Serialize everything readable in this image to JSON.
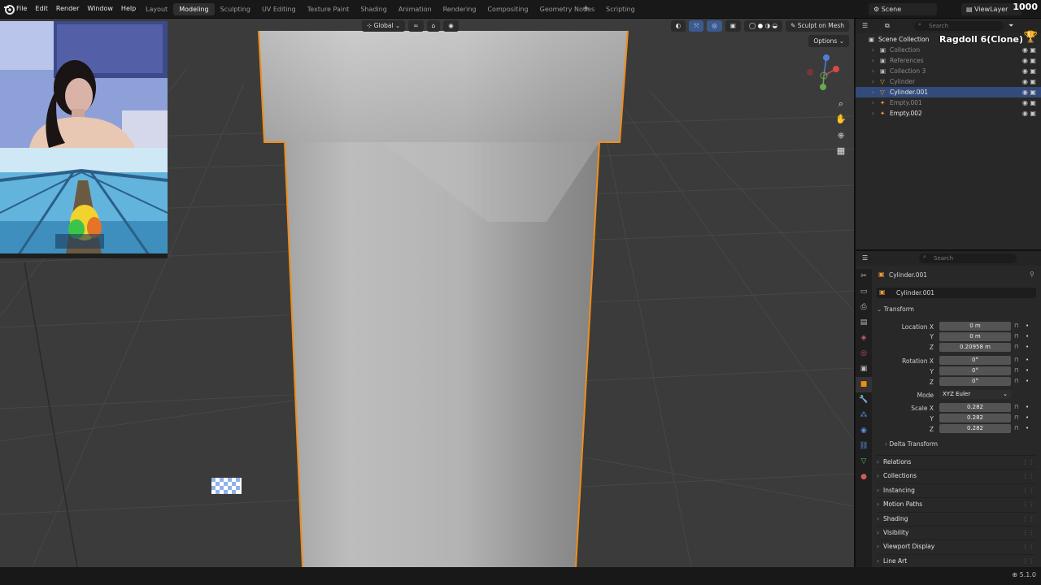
{
  "menu": [
    "File",
    "Edit",
    "Render",
    "Window",
    "Help"
  ],
  "workspaces": [
    {
      "label": "Layout",
      "active": false
    },
    {
      "label": "Modeling",
      "active": true
    },
    {
      "label": "Sculpting",
      "active": false
    },
    {
      "label": "UV Editing",
      "active": false
    },
    {
      "label": "Texture Paint",
      "active": false
    },
    {
      "label": "Shading",
      "active": false
    },
    {
      "label": "Animation",
      "active": false
    },
    {
      "label": "Rendering",
      "active": false
    },
    {
      "label": "Compositing",
      "active": false
    },
    {
      "label": "Geometry Nodes",
      "active": false
    },
    {
      "label": "Scripting",
      "active": false
    }
  ],
  "add_workspace": "+",
  "scene": "Scene",
  "view_layer": "ViewLayer",
  "frame": "1000",
  "viewport": {
    "orientation": "Global",
    "sculpt_on_mesh": "Sculpt on Mesh",
    "options": "Options"
  },
  "outliner": {
    "search_placeholder": "Search",
    "scene_collection": "Scene Collection",
    "overlay_title": "Ragdoll 6(Clone)",
    "items": [
      {
        "name": "Collection",
        "selected": false,
        "dim": true
      },
      {
        "name": "References",
        "selected": false,
        "dim": true
      },
      {
        "name": "Collection 3",
        "selected": false,
        "dim": true
      },
      {
        "name": "Cylinder",
        "selected": false,
        "dim": true
      },
      {
        "name": "Cylinder.001",
        "selected": true,
        "dim": false
      },
      {
        "name": "Empty.001",
        "selected": false,
        "dim": true
      },
      {
        "name": "Empty.002",
        "selected": false,
        "dim": false
      }
    ]
  },
  "properties": {
    "search_placeholder": "Search",
    "object_name": "Cylinder.001",
    "datablock": "Cylinder.001",
    "transform_label": "Transform",
    "location_label": "Location X",
    "location": {
      "x": "0 m",
      "y": "0 m",
      "z": "0.20958 m"
    },
    "rotation_label": "Rotation X",
    "rotation": {
      "x": "0°",
      "y": "0°",
      "z": "0°"
    },
    "mode_label": "Mode",
    "mode": "XYZ Euler",
    "scale_label": "Scale X",
    "scale": {
      "x": "0.282",
      "y": "0.282",
      "z": "0.282"
    },
    "y_label": "Y",
    "z_label": "Z",
    "delta_transform": "Delta Transform",
    "panels": [
      "Relations",
      "Collections",
      "Instancing",
      "Motion Paths",
      "Shading",
      "Visibility",
      "Viewport Display",
      "Line Art"
    ]
  },
  "version": "5.1.0"
}
